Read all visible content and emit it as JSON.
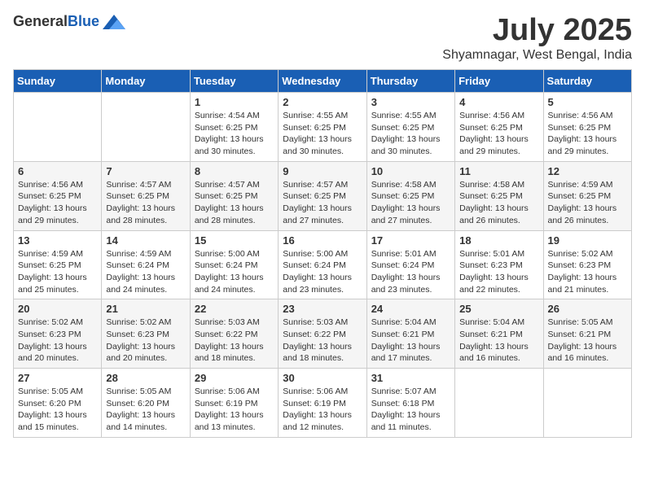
{
  "logo": {
    "general": "General",
    "blue": "Blue"
  },
  "title": "July 2025",
  "location": "Shyamnagar, West Bengal, India",
  "days_of_week": [
    "Sunday",
    "Monday",
    "Tuesday",
    "Wednesday",
    "Thursday",
    "Friday",
    "Saturday"
  ],
  "weeks": [
    [
      {
        "day": "",
        "sunrise": "",
        "sunset": "",
        "daylight": ""
      },
      {
        "day": "",
        "sunrise": "",
        "sunset": "",
        "daylight": ""
      },
      {
        "day": "1",
        "sunrise": "Sunrise: 4:54 AM",
        "sunset": "Sunset: 6:25 PM",
        "daylight": "Daylight: 13 hours and 30 minutes."
      },
      {
        "day": "2",
        "sunrise": "Sunrise: 4:55 AM",
        "sunset": "Sunset: 6:25 PM",
        "daylight": "Daylight: 13 hours and 30 minutes."
      },
      {
        "day": "3",
        "sunrise": "Sunrise: 4:55 AM",
        "sunset": "Sunset: 6:25 PM",
        "daylight": "Daylight: 13 hours and 30 minutes."
      },
      {
        "day": "4",
        "sunrise": "Sunrise: 4:56 AM",
        "sunset": "Sunset: 6:25 PM",
        "daylight": "Daylight: 13 hours and 29 minutes."
      },
      {
        "day": "5",
        "sunrise": "Sunrise: 4:56 AM",
        "sunset": "Sunset: 6:25 PM",
        "daylight": "Daylight: 13 hours and 29 minutes."
      }
    ],
    [
      {
        "day": "6",
        "sunrise": "Sunrise: 4:56 AM",
        "sunset": "Sunset: 6:25 PM",
        "daylight": "Daylight: 13 hours and 29 minutes."
      },
      {
        "day": "7",
        "sunrise": "Sunrise: 4:57 AM",
        "sunset": "Sunset: 6:25 PM",
        "daylight": "Daylight: 13 hours and 28 minutes."
      },
      {
        "day": "8",
        "sunrise": "Sunrise: 4:57 AM",
        "sunset": "Sunset: 6:25 PM",
        "daylight": "Daylight: 13 hours and 28 minutes."
      },
      {
        "day": "9",
        "sunrise": "Sunrise: 4:57 AM",
        "sunset": "Sunset: 6:25 PM",
        "daylight": "Daylight: 13 hours and 27 minutes."
      },
      {
        "day": "10",
        "sunrise": "Sunrise: 4:58 AM",
        "sunset": "Sunset: 6:25 PM",
        "daylight": "Daylight: 13 hours and 27 minutes."
      },
      {
        "day": "11",
        "sunrise": "Sunrise: 4:58 AM",
        "sunset": "Sunset: 6:25 PM",
        "daylight": "Daylight: 13 hours and 26 minutes."
      },
      {
        "day": "12",
        "sunrise": "Sunrise: 4:59 AM",
        "sunset": "Sunset: 6:25 PM",
        "daylight": "Daylight: 13 hours and 26 minutes."
      }
    ],
    [
      {
        "day": "13",
        "sunrise": "Sunrise: 4:59 AM",
        "sunset": "Sunset: 6:25 PM",
        "daylight": "Daylight: 13 hours and 25 minutes."
      },
      {
        "day": "14",
        "sunrise": "Sunrise: 4:59 AM",
        "sunset": "Sunset: 6:24 PM",
        "daylight": "Daylight: 13 hours and 24 minutes."
      },
      {
        "day": "15",
        "sunrise": "Sunrise: 5:00 AM",
        "sunset": "Sunset: 6:24 PM",
        "daylight": "Daylight: 13 hours and 24 minutes."
      },
      {
        "day": "16",
        "sunrise": "Sunrise: 5:00 AM",
        "sunset": "Sunset: 6:24 PM",
        "daylight": "Daylight: 13 hours and 23 minutes."
      },
      {
        "day": "17",
        "sunrise": "Sunrise: 5:01 AM",
        "sunset": "Sunset: 6:24 PM",
        "daylight": "Daylight: 13 hours and 23 minutes."
      },
      {
        "day": "18",
        "sunrise": "Sunrise: 5:01 AM",
        "sunset": "Sunset: 6:23 PM",
        "daylight": "Daylight: 13 hours and 22 minutes."
      },
      {
        "day": "19",
        "sunrise": "Sunrise: 5:02 AM",
        "sunset": "Sunset: 6:23 PM",
        "daylight": "Daylight: 13 hours and 21 minutes."
      }
    ],
    [
      {
        "day": "20",
        "sunrise": "Sunrise: 5:02 AM",
        "sunset": "Sunset: 6:23 PM",
        "daylight": "Daylight: 13 hours and 20 minutes."
      },
      {
        "day": "21",
        "sunrise": "Sunrise: 5:02 AM",
        "sunset": "Sunset: 6:23 PM",
        "daylight": "Daylight: 13 hours and 20 minutes."
      },
      {
        "day": "22",
        "sunrise": "Sunrise: 5:03 AM",
        "sunset": "Sunset: 6:22 PM",
        "daylight": "Daylight: 13 hours and 18 minutes."
      },
      {
        "day": "23",
        "sunrise": "Sunrise: 5:03 AM",
        "sunset": "Sunset: 6:22 PM",
        "daylight": "Daylight: 13 hours and 18 minutes."
      },
      {
        "day": "24",
        "sunrise": "Sunrise: 5:04 AM",
        "sunset": "Sunset: 6:21 PM",
        "daylight": "Daylight: 13 hours and 17 minutes."
      },
      {
        "day": "25",
        "sunrise": "Sunrise: 5:04 AM",
        "sunset": "Sunset: 6:21 PM",
        "daylight": "Daylight: 13 hours and 16 minutes."
      },
      {
        "day": "26",
        "sunrise": "Sunrise: 5:05 AM",
        "sunset": "Sunset: 6:21 PM",
        "daylight": "Daylight: 13 hours and 16 minutes."
      }
    ],
    [
      {
        "day": "27",
        "sunrise": "Sunrise: 5:05 AM",
        "sunset": "Sunset: 6:20 PM",
        "daylight": "Daylight: 13 hours and 15 minutes."
      },
      {
        "day": "28",
        "sunrise": "Sunrise: 5:05 AM",
        "sunset": "Sunset: 6:20 PM",
        "daylight": "Daylight: 13 hours and 14 minutes."
      },
      {
        "day": "29",
        "sunrise": "Sunrise: 5:06 AM",
        "sunset": "Sunset: 6:19 PM",
        "daylight": "Daylight: 13 hours and 13 minutes."
      },
      {
        "day": "30",
        "sunrise": "Sunrise: 5:06 AM",
        "sunset": "Sunset: 6:19 PM",
        "daylight": "Daylight: 13 hours and 12 minutes."
      },
      {
        "day": "31",
        "sunrise": "Sunrise: 5:07 AM",
        "sunset": "Sunset: 6:18 PM",
        "daylight": "Daylight: 13 hours and 11 minutes."
      },
      {
        "day": "",
        "sunrise": "",
        "sunset": "",
        "daylight": ""
      },
      {
        "day": "",
        "sunrise": "",
        "sunset": "",
        "daylight": ""
      }
    ]
  ]
}
